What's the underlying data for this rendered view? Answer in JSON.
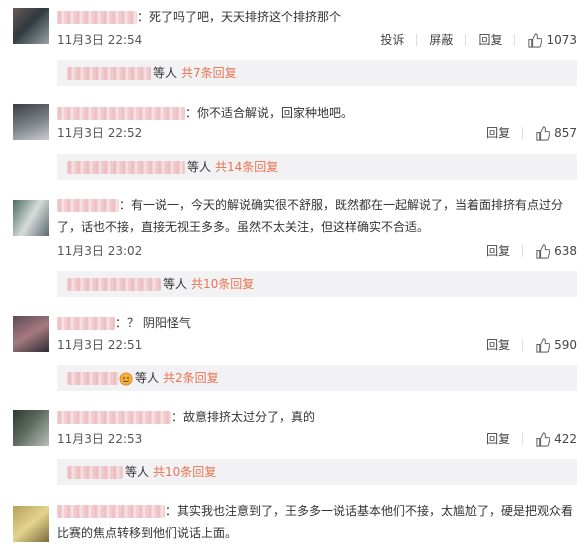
{
  "comments": [
    {
      "text": "死了吗了吧，天天排挤这个排挤那个",
      "time": "11月3日 22:54",
      "report": "投诉",
      "block": "屏蔽",
      "reply": "回复",
      "likes": "1073",
      "replies_who": "等人",
      "replies_count": "共7条回复"
    },
    {
      "text": "你不适合解说，回家种地吧。",
      "time": "11月3日 22:52",
      "reply": "回复",
      "likes": "857",
      "replies_who": "等人",
      "replies_count": "共14条回复"
    },
    {
      "text": "有一说一，今天的解说确实很不舒服，既然都在一起解说了，当着面排挤有点过分了，话也不接，直接无视王多多。虽然不太关注，但这样确实不合适。",
      "time": "11月3日 23:02",
      "reply": "回复",
      "likes": "638",
      "replies_who": "等人",
      "replies_count": "共10条回复"
    },
    {
      "text": "？ 阴阳怪气",
      "time": "11月3日 22:51",
      "reply": "回复",
      "likes": "590",
      "replies_who": "等人",
      "replies_count": "共2条回复"
    },
    {
      "text": "故意排挤太过分了，真的",
      "time": "11月3日 22:53",
      "reply": "回复",
      "likes": "422",
      "replies_who": "等人",
      "replies_count": "共10条回复"
    },
    {
      "text": "其实我也注意到了，王多多一说话基本他们不接，太尴尬了，硬是把观众看比赛的焦点转移到他们说话上面。"
    }
  ],
  "colors": {
    "link": "#eb7350",
    "subbox_bg": "#f2f2f5"
  },
  "icons": {
    "like": "thumbs-up-icon",
    "emoji": "face-emoji-icon"
  }
}
